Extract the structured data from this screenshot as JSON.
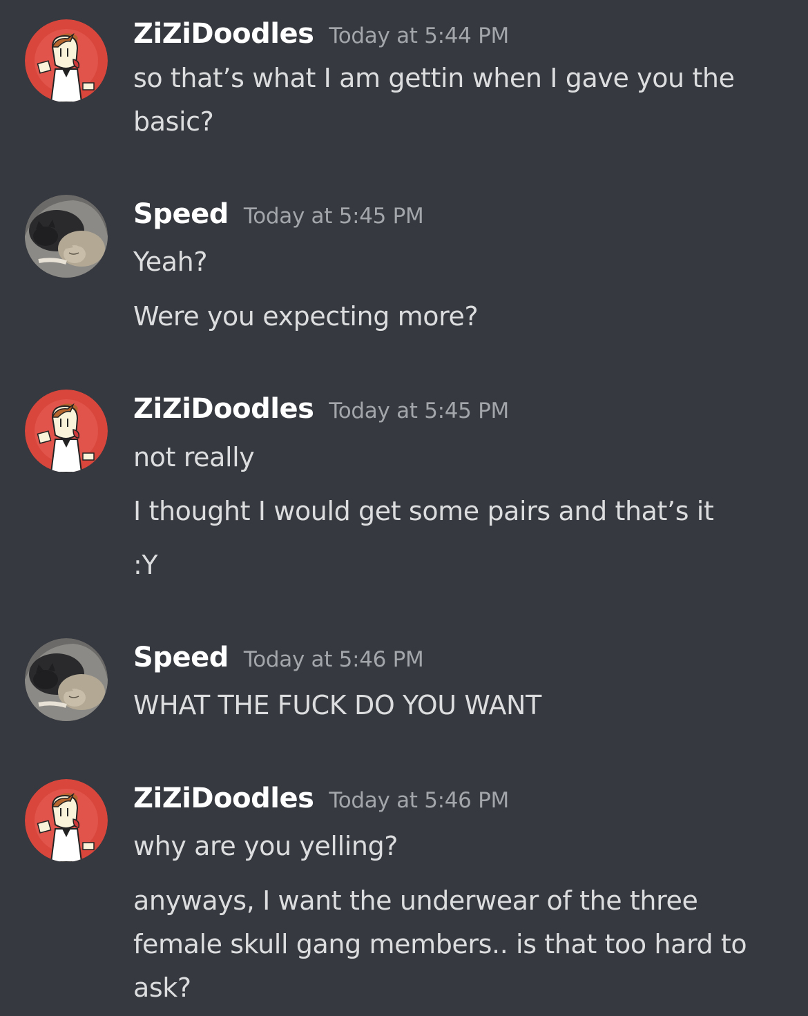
{
  "messages": [
    {
      "author": "ZiZiDoodles",
      "timestamp": "Today at 5:44 PM",
      "avatar_icon": "cartoon-character-avatar",
      "lines": [
        "so that’s what I am gettin when I gave you the basic?"
      ]
    },
    {
      "author": "Speed",
      "timestamp": "Today at 5:45 PM",
      "avatar_icon": "sleeping-cats-avatar",
      "lines": [
        "Yeah?",
        "Were you expecting more?"
      ]
    },
    {
      "author": "ZiZiDoodles",
      "timestamp": "Today at 5:45 PM",
      "avatar_icon": "cartoon-character-avatar",
      "lines": [
        "not really",
        "I thought I would get some pairs and that’s it",
        ":Y"
      ]
    },
    {
      "author": "Speed",
      "timestamp": "Today at 5:46 PM",
      "avatar_icon": "sleeping-cats-avatar",
      "lines": [
        "WHAT THE FUCK DO YOU WANT"
      ]
    },
    {
      "author": "ZiZiDoodles",
      "timestamp": "Today at 5:46 PM",
      "avatar_icon": "cartoon-character-avatar",
      "lines": [
        "why are you yelling?",
        "anyways, I want the underwear of the three female skull gang members.. is that too hard to ask?"
      ]
    }
  ],
  "colors": {
    "background": "#36393f",
    "username": "#ffffff",
    "timestamp": "#a3a6aa",
    "message_text": "#dcddde",
    "avatar_red": "#d9463c"
  }
}
